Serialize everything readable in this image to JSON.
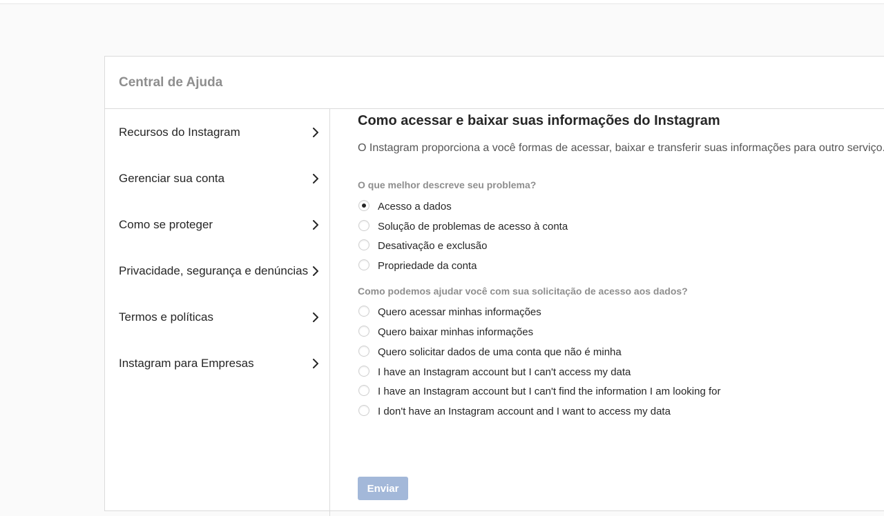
{
  "header": {
    "title": "Central de Ajuda"
  },
  "sidebar": {
    "items": [
      {
        "label": "Recursos do Instagram",
        "icon": "chevron-right-icon"
      },
      {
        "label": "Gerenciar sua conta",
        "icon": "chevron-right-icon"
      },
      {
        "label": "Como se proteger",
        "icon": "chevron-right-icon"
      },
      {
        "label": "Privacidade, segurança e denúncias",
        "icon": "chevron-right-icon"
      },
      {
        "label": "Termos e políticas",
        "icon": "chevron-right-icon"
      },
      {
        "label": "Instagram para Empresas",
        "icon": "chevron-right-icon"
      }
    ]
  },
  "article": {
    "title": "Como acessar e baixar suas informações do Instagram",
    "intro": "O Instagram proporciona a você formas de acessar, baixar e transferir suas informações para outro serviço."
  },
  "form": {
    "question1": {
      "label": "O que melhor descreve seu problema?",
      "selected_index": 0,
      "options": [
        "Acesso a dados",
        "Solução de problemas de acesso à conta",
        "Desativação e exclusão",
        "Propriedade da conta"
      ]
    },
    "question2": {
      "label": "Como podemos ajudar você com sua solicitação de acesso aos dados?",
      "selected_index": null,
      "options": [
        "Quero acessar minhas informações",
        "Quero baixar minhas informações",
        "Quero solicitar dados de uma conta que não é minha",
        "I have an Instagram account but I can't access my data",
        "I have an Instagram account but I can't find the information I am looking for",
        "I don't have an Instagram account and I want to access my data"
      ]
    },
    "submit_label": "Enviar"
  },
  "colors": {
    "submit_bg": "#a3b8d9",
    "header_title": "#8e8e8e",
    "border": "#dbdbdb"
  }
}
